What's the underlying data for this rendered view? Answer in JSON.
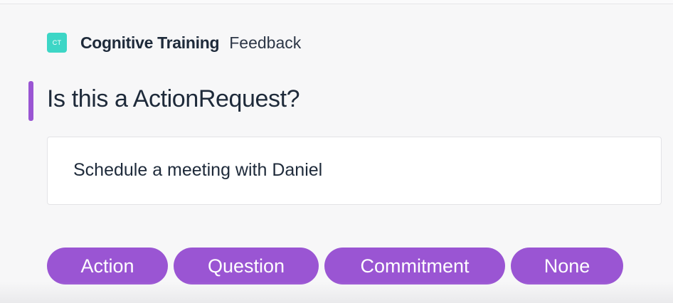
{
  "header": {
    "logo_text": "CT",
    "app_name": "Cognitive Training",
    "section": "Feedback"
  },
  "question": {
    "title": "Is this a ActionRequest?",
    "message": "Schedule a meeting with Daniel"
  },
  "options": {
    "action": "Action",
    "question": "Question",
    "commitment": "Commitment",
    "none": "None"
  },
  "colors": {
    "accent": "#9a55d3",
    "logo": "#3dd6c6",
    "background": "#f7f7f8",
    "text": "#1e2a3a"
  }
}
